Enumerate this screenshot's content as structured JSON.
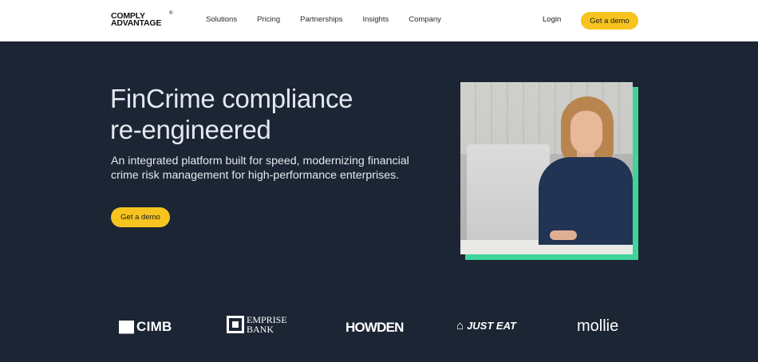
{
  "nav": {
    "logo_line1": "COMPLY",
    "logo_line2": "ADVANTAGE",
    "logo_reg": "®",
    "links": [
      "Solutions",
      "Pricing",
      "Partnerships",
      "Insights",
      "Company"
    ],
    "login": "Login",
    "cta": "Get a demo"
  },
  "hero": {
    "title_line1": "FinCrime compliance",
    "title_line2": "re-engineered",
    "subtitle": "An integrated platform built for speed, modernizing financial crime risk management for high-performance enterprises.",
    "cta": "Get a demo"
  },
  "colors": {
    "nav_bg": "#ffffff",
    "hero_bg": "#1c2534",
    "button": "#f7c41f",
    "accent_green": "#3ed49a"
  },
  "image": {
    "icon": "woman-at-laptop-photo"
  },
  "logos": [
    {
      "name": "CIMB",
      "text": "CIMB"
    },
    {
      "name": "Emprise Bank",
      "text1": "EMPRISE",
      "text2": "BANK"
    },
    {
      "name": "Howden",
      "text": "HOWDEN"
    },
    {
      "name": "Just Eat",
      "text": "JUST EAT"
    },
    {
      "name": "Mollie",
      "text": "mollie"
    }
  ]
}
